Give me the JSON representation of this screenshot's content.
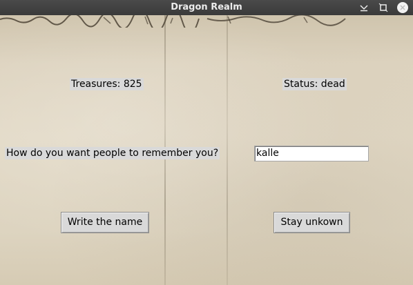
{
  "window": {
    "title": "Dragon Realm"
  },
  "stats": {
    "treasures": "Treasures: 825",
    "status": "Status: dead"
  },
  "prompt": {
    "question": "How do you want people to remember you?",
    "name_value": "kalle"
  },
  "buttons": {
    "write": "Write the name",
    "stay": "Stay unkown"
  }
}
